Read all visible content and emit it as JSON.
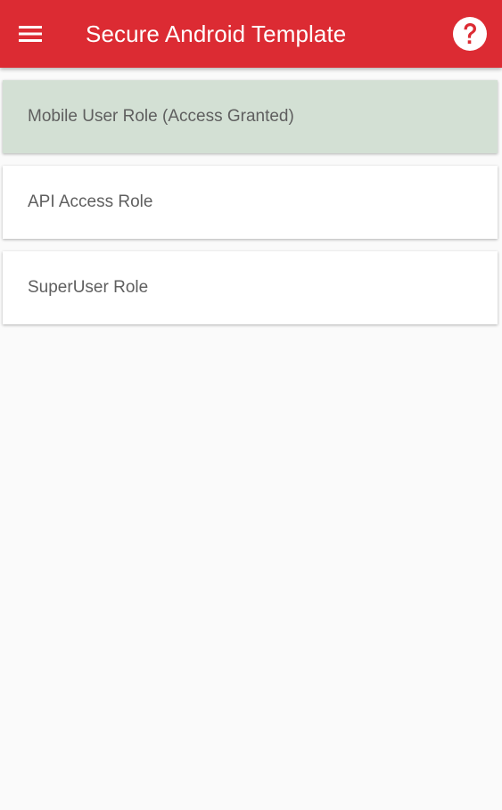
{
  "app_bar": {
    "title": "Secure Android Template",
    "color": "#dc2b33",
    "nav_icon": "hamburger-menu-icon",
    "action_icon": "help-circle-icon"
  },
  "roles": [
    {
      "label": "Mobile User Role (Access Granted)",
      "state": "granted",
      "color": "#d3e0d4"
    },
    {
      "label": "API Access Role",
      "state": "default",
      "color": "#ffffff"
    },
    {
      "label": "SuperUser Role",
      "state": "default",
      "color": "#ffffff"
    }
  ]
}
